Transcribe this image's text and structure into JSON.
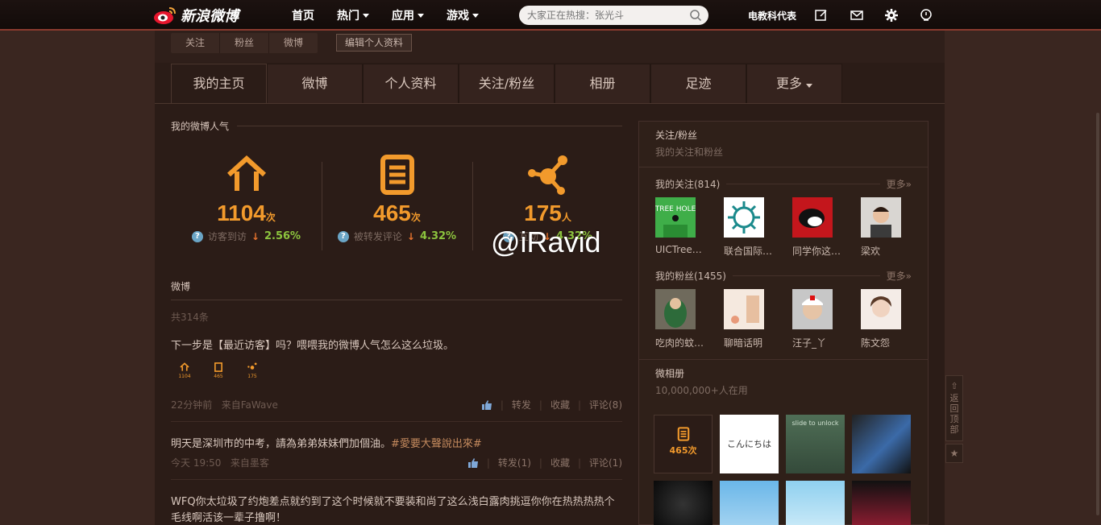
{
  "topbar": {
    "logo_text": "新浪微博",
    "nav": [
      {
        "label": "首页",
        "has_caret": false
      },
      {
        "label": "热门",
        "has_caret": true
      },
      {
        "label": "应用",
        "has_caret": true
      },
      {
        "label": "游戏",
        "has_caret": true
      }
    ],
    "search_placeholder": "大家正在热搜：张光斗",
    "user_name": "电教科代表"
  },
  "profile_strip": {
    "pills": [
      "关注",
      "粉丝",
      "微博"
    ],
    "edit_button": "编辑个人资料"
  },
  "tabs": [
    {
      "label": "我的主页",
      "active": true
    },
    {
      "label": "微博",
      "active": false
    },
    {
      "label": "个人资料",
      "active": false
    },
    {
      "label": "关注/粉丝",
      "active": false
    },
    {
      "label": "相册",
      "active": false
    },
    {
      "label": "足迹",
      "active": false
    },
    {
      "label": "更多",
      "active": false
    }
  ],
  "popularity": {
    "title": "我的微博人气",
    "stats": [
      {
        "icon": "home-icon",
        "value": "1104",
        "unit": "次",
        "label": "访客到访",
        "change": "2.56%"
      },
      {
        "icon": "document-icon",
        "value": "465",
        "unit": "次",
        "label": "被转发评论",
        "change": "4.32%"
      },
      {
        "icon": "share-icon",
        "value": "175",
        "unit": "人",
        "label": "互动",
        "change": "4.32%"
      }
    ]
  },
  "weibo_section": {
    "title": "微博",
    "count": "共314条"
  },
  "posts": [
    {
      "text": "下一步是【最近访客】吗？喂喂我的微博人气怎么这么垃圾。",
      "tag": "",
      "time": "22分钟前",
      "source": "来自FaWave",
      "repost": "转发",
      "fav": "收藏",
      "comment": "评论(8)",
      "mini": [
        "1104",
        "465",
        "175"
      ]
    },
    {
      "text": "明天是深圳市的中考，請為弟弟妹妹們加個油。",
      "tag": "#愛要大聲說出來#",
      "time": "今天 19:50",
      "source": "来自墨客",
      "repost": "转发(1)",
      "fav": "收藏",
      "comment": "评论(1)"
    },
    {
      "text": "WFQ你太垃圾了约炮差点就约到了这个时候就不要装和尚了这么浅白露肉挑逗你你在热热热热个毛线啊活该一辈子撸啊！",
      "tag": ""
    }
  ],
  "watermark": "@iRavid",
  "right_panel": {
    "title": "关注/粉丝",
    "subtitle": "我的关注和粉丝",
    "following_head": "我的关注(814)",
    "more": "更多»",
    "following": [
      "UICTree…",
      "联合国际…",
      "同学你这…",
      "梁欢"
    ],
    "followers_head": "我的粉丝(1455)",
    "followers": [
      "吃肉的蚊…",
      "聊暗话明",
      "汪子_丫",
      "陈文怨"
    ],
    "album_title": "微相册",
    "album_sub": "10,000,000+人在用",
    "album_tiles": [
      "465次",
      "こんにちは",
      "slide to unlock",
      "",
      "",
      "",
      "",
      ""
    ],
    "avatar_caption": "TREE HOLE"
  },
  "backtop": {
    "label": "返回顶部",
    "star": "★"
  },
  "colors": {
    "accent": "#f29a2c",
    "positive": "#8cc43e",
    "down": "#e6732e",
    "bg": "#3a2620"
  }
}
